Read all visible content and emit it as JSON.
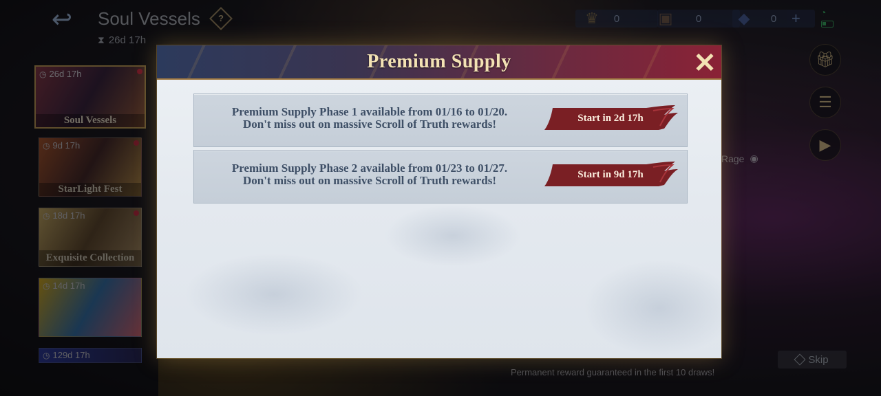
{
  "header": {
    "title": "Soul Vessels",
    "countdown": "26d  17h"
  },
  "currencies": [
    {
      "icon": "ticket-icon",
      "value": "0"
    },
    {
      "icon": "chest-icon",
      "value": "0"
    },
    {
      "icon": "diamond-icon",
      "value": "0"
    }
  ],
  "events": [
    {
      "timer": "26d  17h",
      "label": "Soul Vessels",
      "active": true
    },
    {
      "timer": "9d  17h",
      "label": "StarLight Fest"
    },
    {
      "timer": "18d  17h",
      "label": "Exquisite Collection"
    },
    {
      "timer": "14d  17h",
      "label": ""
    },
    {
      "timer": "129d  17h",
      "label": ""
    }
  ],
  "background": {
    "rage_label": "Rage",
    "skip_label": "Skip",
    "footer_note": "Permanent reward guaranteed in the first 10 draws!"
  },
  "modal": {
    "title": "Premium Supply",
    "close_symbol": "✕",
    "rows": [
      {
        "line1": "Premium Supply Phase 1 available from 01/16 to 01/20.",
        "line2": "Don't miss out on massive Scroll of Truth rewards!",
        "start": "Start in 2d  17h"
      },
      {
        "line1": "Premium Supply Phase 2 available from 01/23 to 01/27.",
        "line2": "Don't miss out on massive Scroll of Truth rewards!",
        "start": "Start in 9d  17h"
      }
    ]
  },
  "colors": {
    "badge_red": "#7a1f24",
    "title_gold": "#f3e2b4",
    "row_text": "#3e4f66"
  }
}
